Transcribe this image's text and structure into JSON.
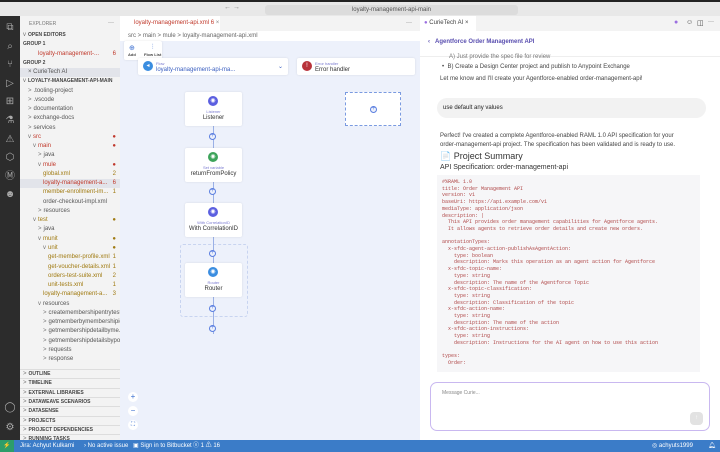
{
  "titlebar": {
    "search": "loyalty-management-api-main",
    "nav": "← →"
  },
  "activity_icons": [
    "files-icon",
    "search-icon",
    "source-control-icon",
    "run-debug-icon",
    "extensions-icon",
    "testing-icon",
    "warning-icon",
    "mulesoft-icon",
    "mule-m-icon",
    "curie-icon"
  ],
  "sidebar": {
    "title": "EXPLORER",
    "more": "···",
    "rows": [
      {
        "t": "OPEN EDITORS",
        "d": 0,
        "h": true,
        "c": "v"
      },
      {
        "t": "GROUP 1",
        "d": 0,
        "h": true
      },
      {
        "t": "loyalty-management-...",
        "d": 3,
        "col": "#c0392b",
        "b": "6"
      },
      {
        "t": "GROUP 2",
        "d": 0,
        "h": true
      },
      {
        "t": "× CurieTech AI",
        "d": 1,
        "sel": true
      },
      {
        "t": "LOYALTY-MANAGEMENT-API-MAIN",
        "d": 0,
        "h": true,
        "c": "v"
      },
      {
        "t": ".tooling-project",
        "d": 1,
        "c": ">"
      },
      {
        "t": ".vscode",
        "d": 1,
        "c": ">"
      },
      {
        "t": "documentation",
        "d": 1,
        "c": ">"
      },
      {
        "t": "exchange-docs",
        "d": 1,
        "c": ">"
      },
      {
        "t": "services",
        "d": 1,
        "c": ">"
      },
      {
        "t": "src",
        "d": 1,
        "c": "v",
        "col": "#c0392b",
        "b": "●"
      },
      {
        "t": "main",
        "d": 2,
        "c": "v",
        "col": "#c0392b",
        "b": "●"
      },
      {
        "t": "java",
        "d": 3,
        "c": ">"
      },
      {
        "t": "mule",
        "d": 3,
        "c": "v",
        "col": "#c0392b",
        "b": "●"
      },
      {
        "t": "global.xml",
        "d": 4,
        "col": "#a07a10",
        "b": "2"
      },
      {
        "t": "loyalty-management-a...",
        "d": 4,
        "col": "#c0392b",
        "b": "6",
        "sel": true
      },
      {
        "t": "member-enrollment-im...",
        "d": 4,
        "col": "#a07a10",
        "b": "1"
      },
      {
        "t": "order-checkout-impl.xml",
        "d": 4
      },
      {
        "t": "resources",
        "d": 3,
        "c": ">"
      },
      {
        "t": "test",
        "d": 2,
        "c": "v",
        "col": "#a07a10",
        "b": "●"
      },
      {
        "t": "java",
        "d": 3,
        "c": ">"
      },
      {
        "t": "munit",
        "d": 3,
        "c": "v",
        "col": "#a07a10",
        "b": "●"
      },
      {
        "t": "unit",
        "d": 4,
        "c": "v",
        "col": "#a07a10",
        "b": "●"
      },
      {
        "t": "get-member-profile.xml",
        "d": 5,
        "col": "#a07a10",
        "b": "1"
      },
      {
        "t": "get-voucher-details.xml",
        "d": 5,
        "col": "#a07a10",
        "b": "1"
      },
      {
        "t": "orders-test-suite.xml",
        "d": 5,
        "col": "#a07a10",
        "b": "2"
      },
      {
        "t": "unit-tests.xml",
        "d": 5,
        "col": "#a07a10",
        "b": "1"
      },
      {
        "t": "loyalty-management-a...",
        "d": 4,
        "col": "#a07a10",
        "b": "3"
      },
      {
        "t": "resources",
        "d": 3,
        "c": "v"
      },
      {
        "t": "createmembershipentrytest",
        "d": 4,
        "c": ">"
      },
      {
        "t": "getmemberbymembershipid",
        "d": 4,
        "c": ">"
      },
      {
        "t": "getmembershipdetailbyme...",
        "d": 4,
        "c": ">"
      },
      {
        "t": "getmembershipdetailsbypo...",
        "d": 4,
        "c": ">"
      },
      {
        "t": "requests",
        "d": 4,
        "c": ">"
      },
      {
        "t": "response",
        "d": 4,
        "c": ">"
      }
    ],
    "panels": [
      "OUTLINE",
      "TIMELINE",
      "EXTERNAL LIBRARIES",
      "DATAWEAVE SCENARIOS",
      "DATASENSE",
      "PROJECTS",
      "PROJECT DEPENDENCIES",
      "RUNNING TASKS"
    ]
  },
  "editor": {
    "tab": "loyalty-management-api.xml 6",
    "tab_close": "×",
    "more": "···",
    "breadcrumb": "src > main > mule > loyalty-management-api.xml",
    "toolbar": {
      "add": "Add",
      "flow_list": "Flow List"
    },
    "flow": {
      "label": "Flow",
      "name": "loyalty-management-api-ma..."
    },
    "error_handler": {
      "label": "Error handler",
      "name": "Error handler"
    },
    "nodes": [
      {
        "label": "Listener",
        "name": "Listener",
        "color": "#5b5fe0"
      },
      {
        "label": "Set variable",
        "name": "returnFromPolicy",
        "color": "#3ca35a"
      },
      {
        "label": "With CorrelationID",
        "name": "With CorrelationID",
        "color": "#5b5fe0"
      },
      {
        "label": "Router",
        "name": "Router",
        "color": "#3a8de0"
      }
    ]
  },
  "right": {
    "tab": "CurieTech AI",
    "back_title": "Agentforce Order Management API",
    "msg_cut": "A) Just provide the spec file for review",
    "msg_b": "B) Create a Design Center project and publish to Anypoint Exchange",
    "msg_let": "Let me know and I'll create your Agentforce-enabled order-management-api!",
    "user_msg": "use default any values",
    "reply": "Perfect! I've created a complete Agentforce-enabled RAML 1.0 API specification for your order-management-api project. The specification has been validated and is ready to use.",
    "summary_title": "📄 Project Summary",
    "api_spec": "API Specification: order-management-api",
    "code": "#%RAML 1.0\ntitle: Order Management API\nversion: v1\nbaseUri: https://api.example.com/v1\nmediaType: application/json\ndescription: |\n  This API provides order management capabilities for Agentforce agents.\n  It allows agents to retrieve order details and create new orders.\n\nannotationTypes:\n  x-sfdc-agent-action-publishAsAgentAction:\n    type: boolean\n    description: Marks this operation as an agent action for Agentforce\n  x-sfdc-topic-name:\n    type: string\n    description: The name of the Agentforce Topic\n  x-sfdc-topic-classification:\n    type: string\n    description: Classification of the topic\n  x-sfdc-action-name:\n    type: string\n    description: The name of the action\n  x-sfdc-action-instructions:\n    type: string\n    description: Instructions for the AI agent on how to use this action\n\ntypes:\n  Order:",
    "input_placeholder": "Message Curie..."
  },
  "status": {
    "jira": "Jira: Achyut Kulkarni",
    "issue": "No active issue",
    "bitbucket": "Sign in to Bitbucket",
    "problems": "ⓧ 1 ⚠ 16",
    "user": "achyuts1999"
  },
  "colors": {
    "status_bar": "#3b7cc8",
    "accent": "#7b5fe0",
    "error": "#c0392b"
  }
}
